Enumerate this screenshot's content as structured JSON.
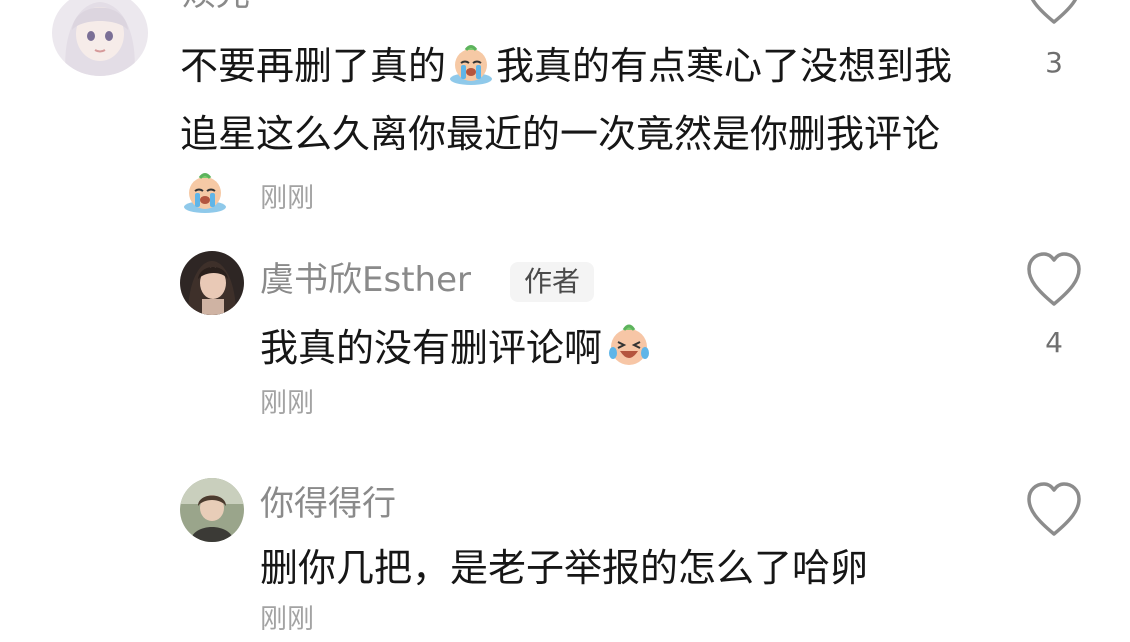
{
  "comments": [
    {
      "username": "烦光",
      "text_parts": [
        "不要再删了真的",
        "我真的有点寒心了没想到我追星这么久离你最近的一次竟然是你删我评论"
      ],
      "emojis": [
        "crying-face-emoji",
        "crying-face-emoji"
      ],
      "time": "刚刚",
      "likes": "3"
    },
    {
      "username": "虞书欣Esther",
      "badge": "作者",
      "text": "我真的没有删评论啊",
      "emoji": "laughing-crying-face-emoji",
      "time": "刚刚",
      "likes": "4"
    },
    {
      "username": "你得得行",
      "text": "删你几把，是老子举报的怎么了哈卵",
      "time": "刚刚"
    }
  ],
  "icons": {
    "like": "heart-outline-icon"
  },
  "colors": {
    "username": "#8a8a8a",
    "text": "#161616",
    "time": "#a3a3a3",
    "heart": "#8c8c8c"
  }
}
